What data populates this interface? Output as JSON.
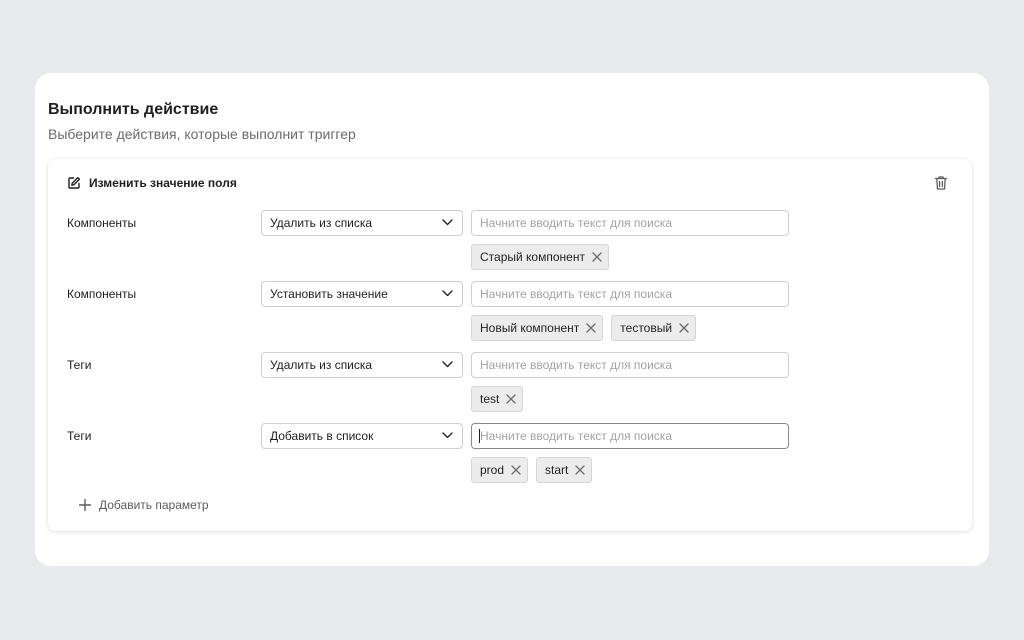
{
  "page": {
    "title": "Выполнить действие",
    "subtitle": "Выберите действия, которые выполнит триггер"
  },
  "action": {
    "title": "Изменить значение поля",
    "edit_icon": "edit-icon",
    "delete_icon": "trash-icon"
  },
  "rows": [
    {
      "label": "Компоненты",
      "operation": "Удалить из списка",
      "search_placeholder": "Начните вводить текст для поиска",
      "chips": [
        "Старый компонент"
      ]
    },
    {
      "label": "Компоненты",
      "operation": "Установить значение",
      "search_placeholder": "Начните вводить текст для поиска",
      "chips": [
        "Новый компонент",
        "тестовый"
      ]
    },
    {
      "label": "Теги",
      "operation": "Удалить из списка",
      "search_placeholder": "Начните вводить текст для поиска",
      "chips": [
        "test"
      ]
    },
    {
      "label": "Теги",
      "operation": "Добавить в список",
      "search_placeholder": "Начните вводить текст для поиска",
      "chips": [
        "prod",
        "start"
      ],
      "focused": true
    }
  ],
  "add_param": {
    "label": "Добавить параметр",
    "icon": "plus-icon"
  },
  "colors": {
    "background": "#e9eaed",
    "card": "#ffffff",
    "chip": "#ececec",
    "placeholder": "#a3a3a3"
  }
}
